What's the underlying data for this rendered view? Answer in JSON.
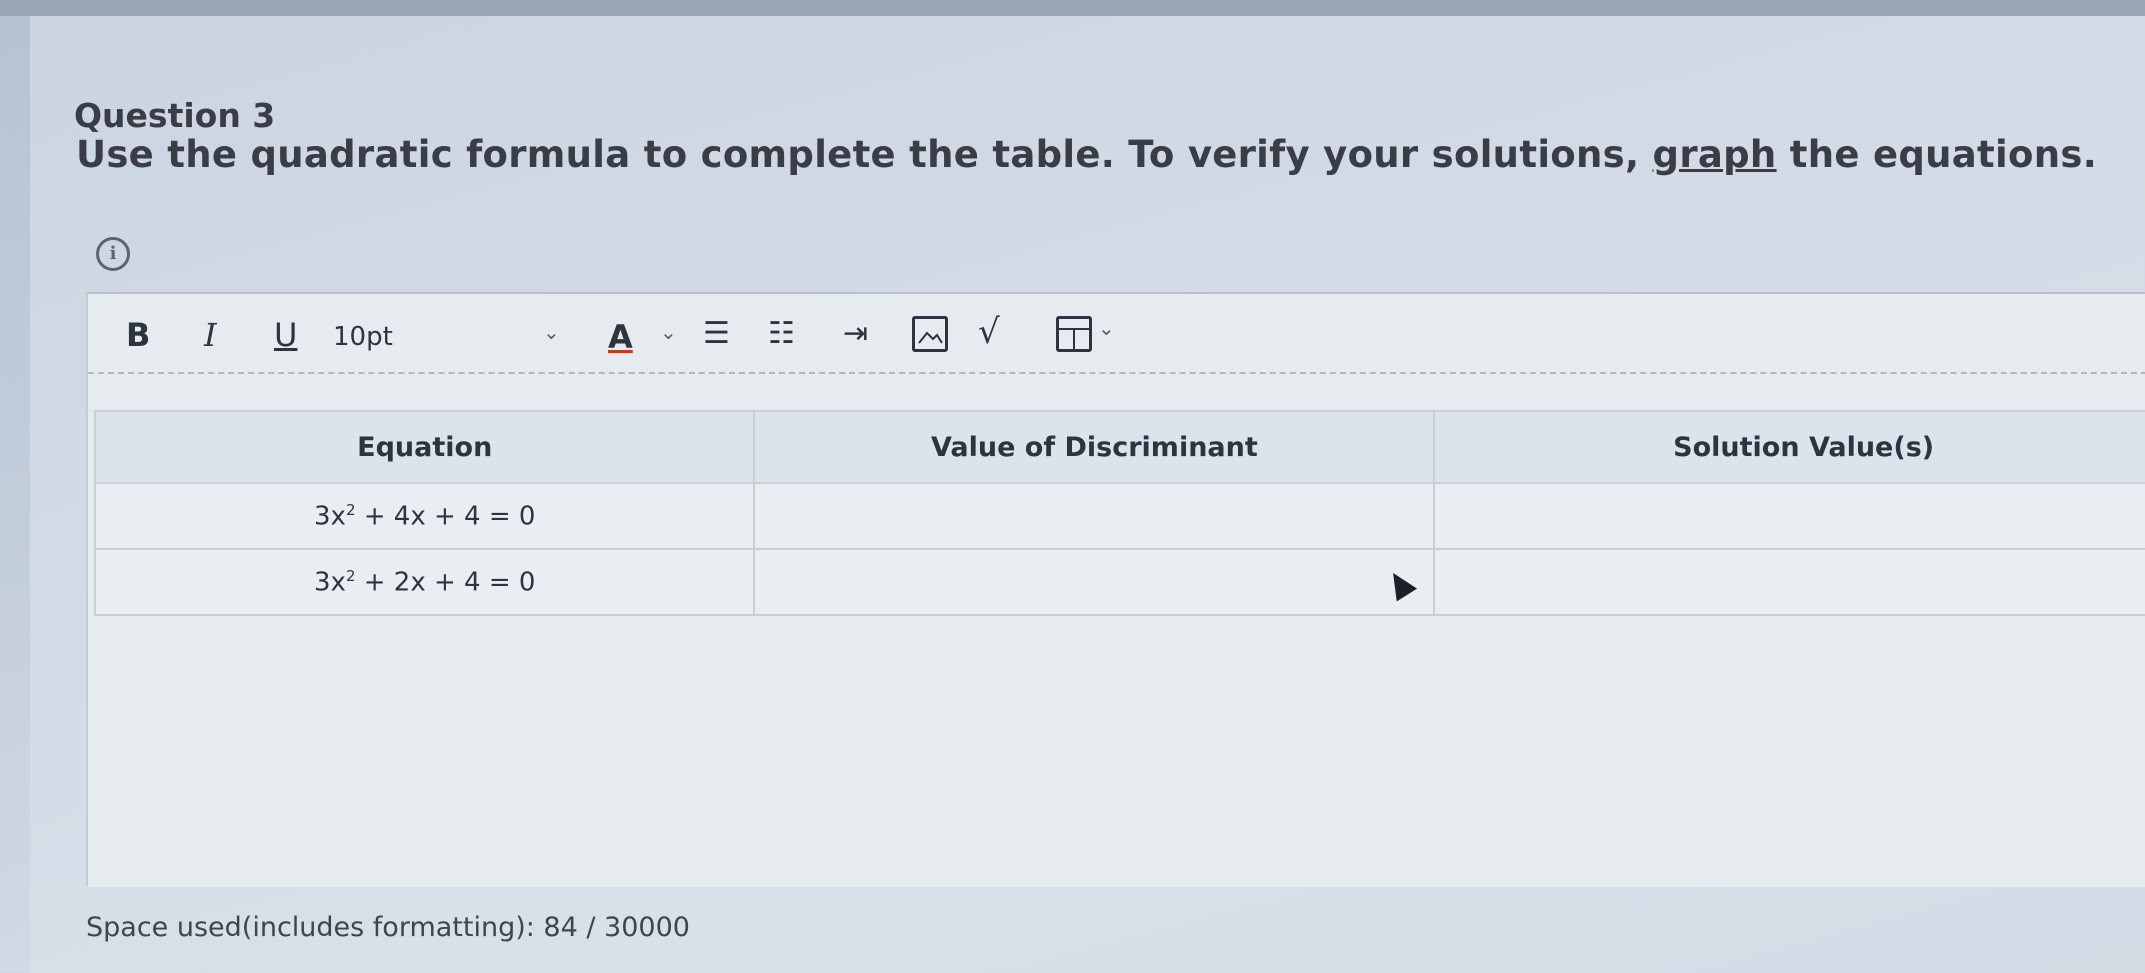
{
  "question": {
    "number": "Question 3",
    "prompt_before": "Use the quadratic formula to complete the table. To verify your solutions, ",
    "prompt_link": "graph",
    "prompt_after": " the equations."
  },
  "toolbar": {
    "bold": "B",
    "italic": "I",
    "underline": "U",
    "font_size": "10pt",
    "font_color": "A",
    "chevron": "⌄",
    "bullet_list": "☰",
    "numbered_list": "☷",
    "indent": "⇥"
  },
  "table": {
    "headers": [
      "Equation",
      "Value of Discriminant",
      "Solution Value(s)"
    ],
    "rows": [
      {
        "eq_a": "3x",
        "eq_exp": "2",
        "eq_b": " + 4x + 4 = 0",
        "discriminant": "",
        "solutions": ""
      },
      {
        "eq_a": "3x",
        "eq_exp": "2",
        "eq_b": " + 2x + 4 = 0",
        "discriminant": "",
        "solutions": ""
      }
    ]
  },
  "footer": {
    "space_used": "Space used(includes formatting): 84 / 30000"
  },
  "icons": [
    "info-icon",
    "bold-icon",
    "italic-icon",
    "underline-icon",
    "chevron-down-icon",
    "text-color-icon",
    "bullet-list-icon",
    "numbered-list-icon",
    "indent-icon",
    "image-icon",
    "math-icon",
    "table-icon",
    "cursor-icon"
  ]
}
